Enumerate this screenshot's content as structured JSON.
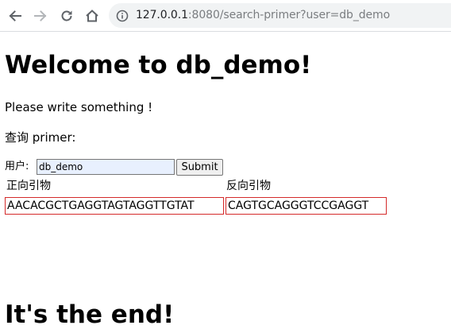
{
  "browser": {
    "url_host": "127.0.0.1",
    "url_rest": ":8080/search-primer?user=db_demo",
    "icons": [
      "back-arrow-icon",
      "forward-arrow-icon",
      "reload-icon",
      "home-icon",
      "info-icon"
    ]
  },
  "page": {
    "title": "Welcome to db_demo!",
    "intro": "Please write something !",
    "query_label": "查询 primer:",
    "form": {
      "user_label": "用户:",
      "user_value": "db_demo",
      "submit_label": "Submit"
    },
    "table": {
      "headers": [
        "正向引物",
        "反向引物"
      ],
      "rows": [
        [
          "AACACGCTGAGGTAGTAGGTTGTAT",
          "CAGTGCAGGGTCCGAGGT"
        ]
      ]
    },
    "end_text": "It's the end!"
  },
  "colors": {
    "cell_border": "#d42a2a",
    "input_autofill_bg": "#e8f0fe",
    "omnibox_bg": "#f1f3f4"
  }
}
